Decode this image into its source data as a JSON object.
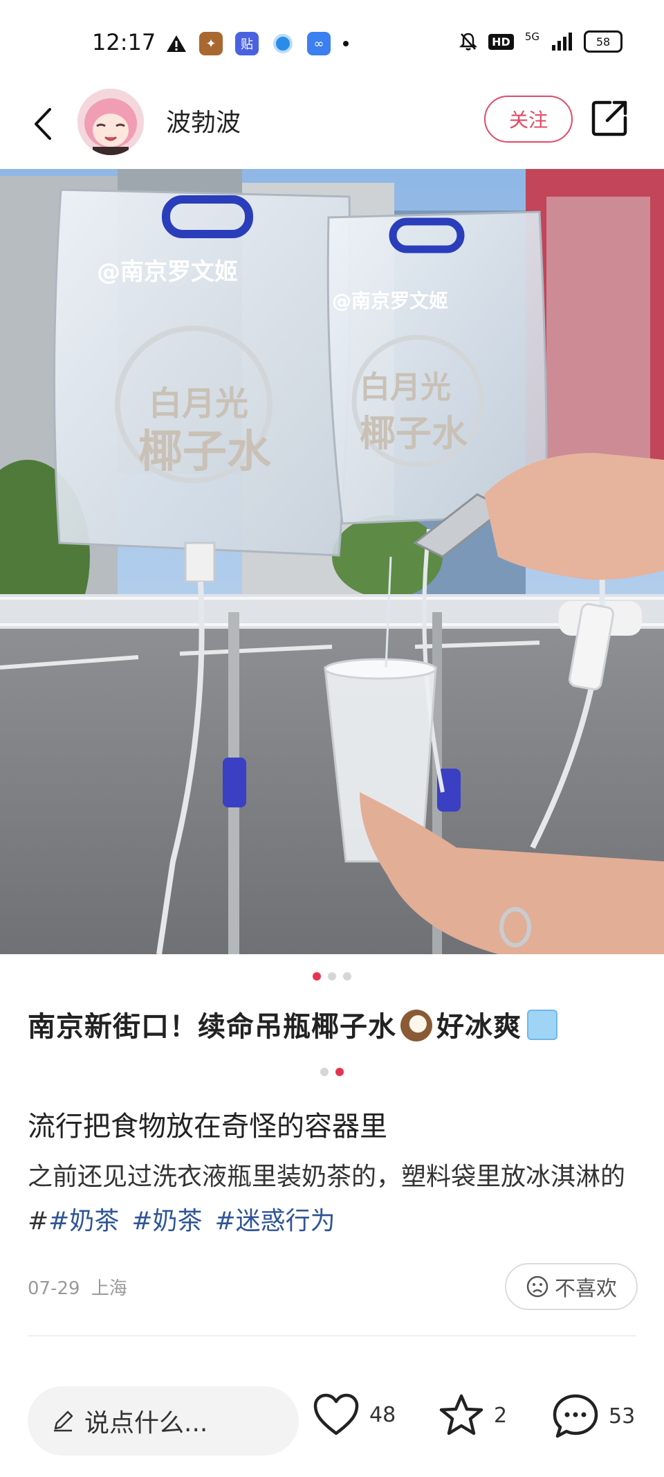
{
  "status_bar": {
    "time": "12:17",
    "network": "5G",
    "hd": "HD",
    "battery": "58"
  },
  "header": {
    "author": "波勃波",
    "follow_label": "关注"
  },
  "photo": {
    "watermark": "@南京罗文姬",
    "bag_brand_line1": "白月光",
    "bag_brand_line2": "椰子水",
    "bag2_watermark": "@南京罗文姬"
  },
  "post": {
    "title": "南京新街口！续命吊瓶椰子水",
    "title_suffix": "好冰爽",
    "subtitle": "流行把食物放在奇怪的容器里",
    "body": "之前还见过洗衣液瓶里装奶茶的，塑料袋里放冰淇淋的#",
    "tags": [
      "#奶茶",
      "#奶茶",
      "#迷惑行为"
    ],
    "date": "07-29",
    "location": "上海",
    "dislike_label": "不喜欢"
  },
  "bottom_bar": {
    "comment_placeholder": "说点什么...",
    "likes": "48",
    "stars": "2",
    "comments": "53"
  },
  "colors": {
    "accent": "#e04a64",
    "tag": "#2f5597",
    "dot_active": "#e8334f"
  }
}
